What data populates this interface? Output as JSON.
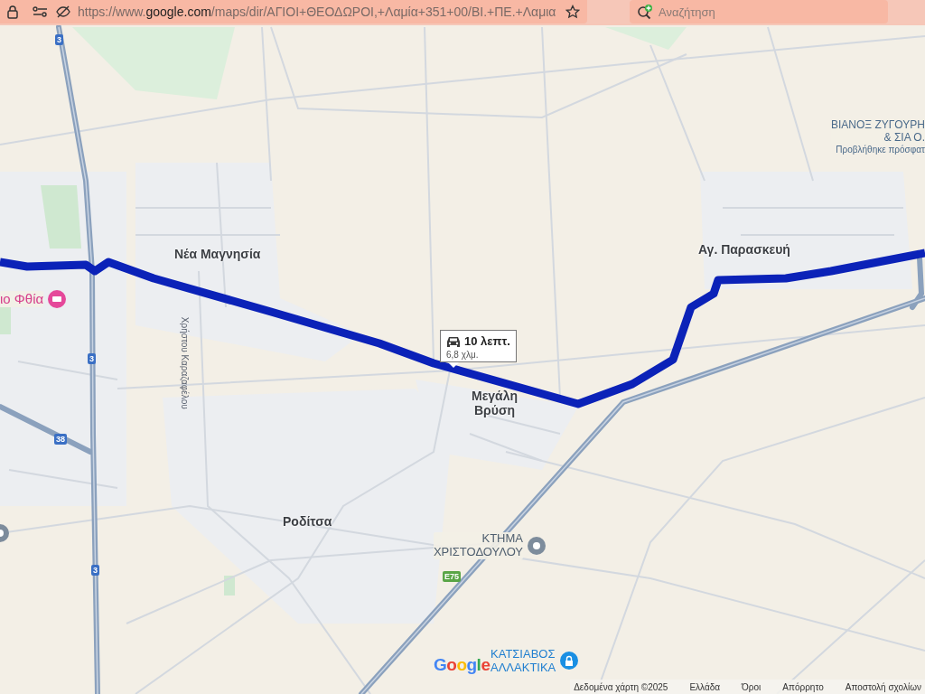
{
  "browser": {
    "url_prefix": "https://www.",
    "url_host": "google.com",
    "url_rest": "/maps/dir/ΑΓΙΟΙ+ΘΕΟΔΩΡΟΙ,+Λαμία+351+00/ΒΙ.+ΠΕ.+Λαμια",
    "search": {
      "placeholder": "Αναζήτηση"
    }
  },
  "map": {
    "places": [
      {
        "kind": "town",
        "lines": [
          "Νέα Μαγνησία"
        ]
      },
      {
        "kind": "town",
        "lines": [
          "Αγ. Παρασκευή"
        ]
      },
      {
        "kind": "town",
        "lines": [
          "Μεγάλη",
          "Βρύση"
        ]
      },
      {
        "kind": "town",
        "lines": [
          "Ροδίτσα"
        ]
      },
      {
        "kind": "hotel",
        "lines": [
          "ιο Φθία"
        ]
      },
      {
        "kind": "pin",
        "lines": [
          "ΚΤΗΜΑ",
          "ΧΡΙΣΤΟΔΟΥΛΟΥ"
        ]
      },
      {
        "kind": "shop",
        "lines": [
          "ΚΑΤΣΙΑΒΟΣ",
          "ΑΛΛΑΚΤΙΚΑ"
        ]
      },
      {
        "kind": "business",
        "lines": [
          "ΒΙΑΝΟΞ ΖΥΓΟΥΡΗ",
          "& ΣΙΑ Ο."
        ],
        "note": "Προβλήθηκε πρόσφατ"
      }
    ],
    "street": "Χρήστου Καραζαφέλου",
    "shields": [
      {
        "label": "3",
        "kind": "national"
      },
      {
        "label": "3",
        "kind": "national"
      },
      {
        "label": "38",
        "kind": "national"
      },
      {
        "label": "3",
        "kind": "national"
      },
      {
        "label": "E75",
        "kind": "european"
      }
    ],
    "route_info": {
      "duration": "10 λεπτ.",
      "distance": "6,8 χλμ."
    },
    "logo": "Google",
    "footer": [
      "Δεδομένα χάρτη ©2025",
      "Ελλάδα",
      "Όροι",
      "Απόρρητο",
      "Αποστολή σχολίων"
    ]
  }
}
